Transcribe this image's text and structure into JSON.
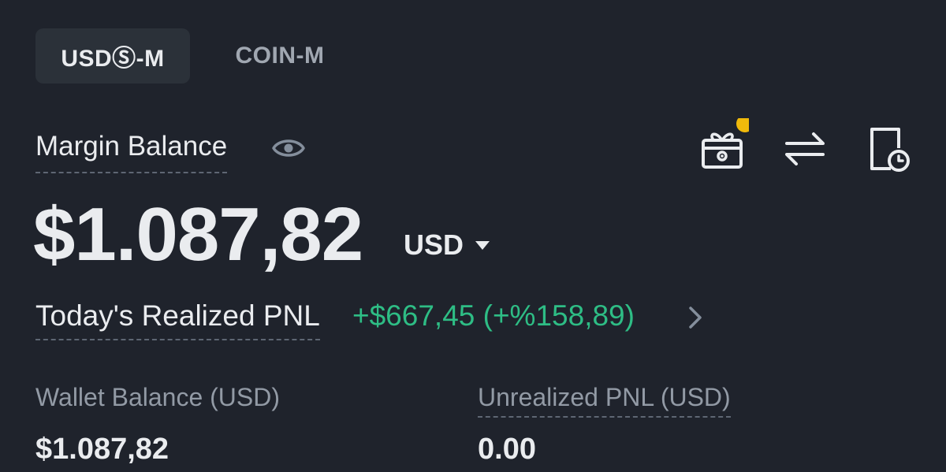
{
  "tabs": [
    {
      "label": "USDⓈ-M",
      "active": true
    },
    {
      "label": "COIN-M",
      "active": false
    }
  ],
  "margin_balance": {
    "label": "Margin Balance",
    "value": "$1.087,82",
    "currency": "USD"
  },
  "todays_pnl": {
    "label": "Today's Realized PNL",
    "value": "+$667,45 (+%158,89)"
  },
  "wallet_balance": {
    "label": "Wallet Balance (USD)",
    "value": "$1.087,82"
  },
  "unrealized_pnl": {
    "label": "Unrealized PNL (USD)",
    "value": "0.00"
  },
  "icons": {
    "eye": "eye-icon",
    "gift": "gift-icon",
    "transfer": "transfer-icon",
    "history": "history-icon",
    "caret": "caret-down-icon",
    "chevron": "chevron-right-icon"
  },
  "colors": {
    "background": "#1f232c",
    "active_tab": "#2b3139",
    "positive": "#2ebd85",
    "notification_dot": "#f0b90b"
  }
}
